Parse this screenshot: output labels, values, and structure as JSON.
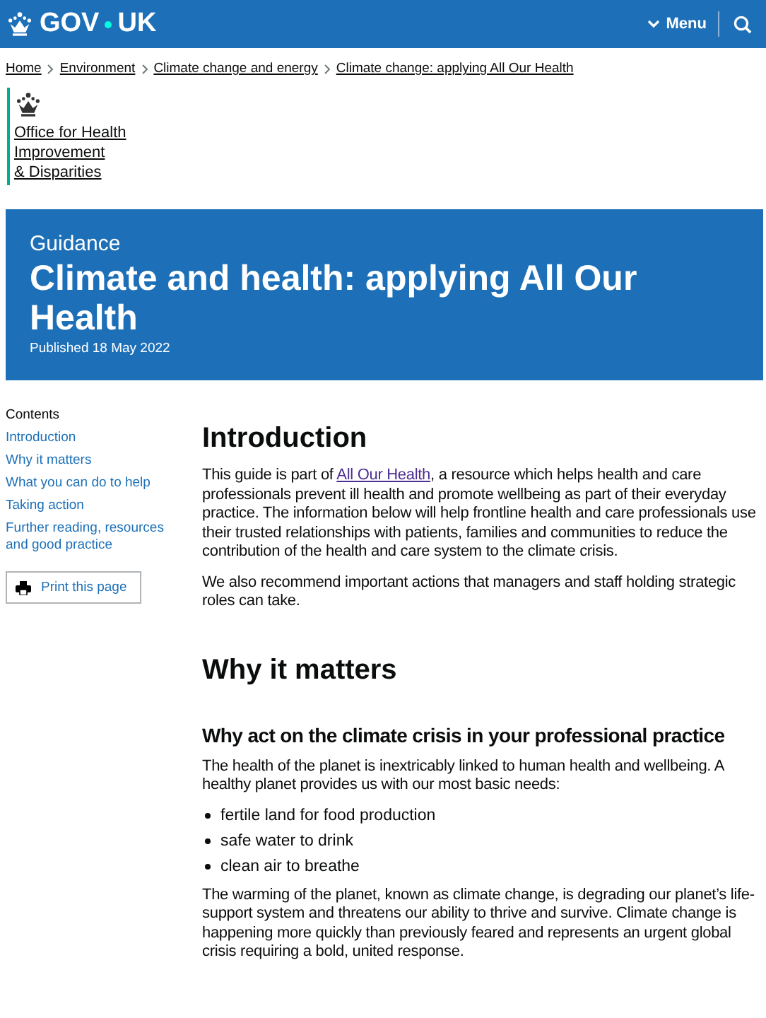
{
  "header": {
    "logo_parts": [
      "GOV",
      "UK"
    ],
    "menu": "Menu"
  },
  "breadcrumbs": [
    "Home",
    "Environment",
    "Climate change and energy",
    "Climate change: applying All Our Health"
  ],
  "organisation": {
    "name_lines": [
      "Office for Health",
      "Improvement",
      "& Disparities"
    ]
  },
  "banner": {
    "context": "Guidance",
    "title": "Climate and health: applying All Our Health",
    "published": "Published 18 May 2022"
  },
  "contents": {
    "heading": "Contents",
    "items": [
      "Introduction",
      "Why it matters",
      "What you can do to help",
      "Taking action",
      "Further reading, resources and good practice"
    ],
    "print": "Print this page"
  },
  "body": [
    {
      "kind": "h2",
      "text": "Introduction"
    },
    {
      "kind": "p",
      "text": "This guide is part of ",
      "link": "All Our Health",
      "rest": ", a resource which helps health and care professionals prevent ill health and promote wellbeing as part of their everyday practice. The information below will help frontline health and care professionals use their trusted relationships with patients, families and communities to reduce the contribution of the health and care system to the climate crisis."
    },
    {
      "kind": "p",
      "text": "We also recommend important actions that managers and staff holding strategic roles can take."
    },
    {
      "kind": "h2",
      "text": "Why it matters"
    },
    {
      "kind": "h3",
      "text": "Why act on the climate crisis in your professional practice"
    },
    {
      "kind": "p",
      "text": "The health of the planet is inextricably linked to human health and wellbeing. A healthy planet provides us with our most basic needs:"
    },
    {
      "kind": "list",
      "items": [
        "fertile land for food production",
        "safe water to drink",
        "clean air to breathe"
      ]
    },
    {
      "kind": "p",
      "text": "The warming of the planet, known as climate change, is degrading our planet’s life-support system and threatens our ability to thrive and survive. Climate change is happening more quickly than previously feared and represents an urgent global crisis requiring a bold, united response."
    }
  ]
}
